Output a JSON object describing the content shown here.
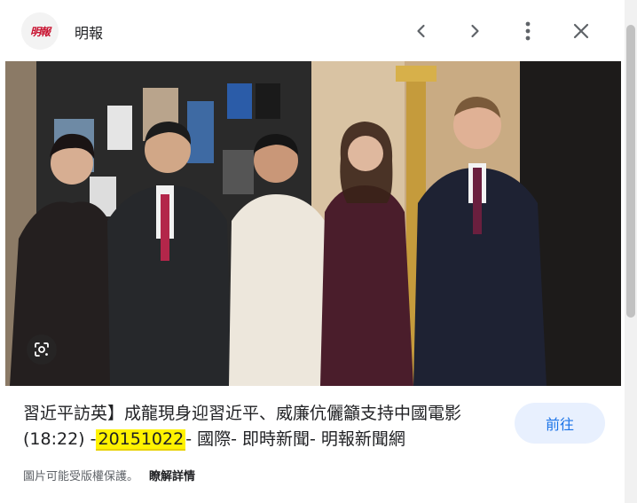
{
  "header": {
    "logo_text": "明報",
    "site_name": "明報",
    "prev_icon": "chevron-left-icon",
    "next_icon": "chevron-right-icon",
    "more_icon": "more-vert-icon",
    "close_icon": "close-icon"
  },
  "image": {
    "lens_icon": "google-lens-icon"
  },
  "result": {
    "title_part1": "習近平訪英】成龍現身迎習近平、威廉伉儷籲支持中國電影(18:22) -",
    "title_highlight": "20151022",
    "title_part2": "- 國際- 即時新聞- 明報新聞網",
    "go_button": "前往",
    "copyright_note": "圖片可能受版權保護。",
    "details_link": "瞭解詳情"
  },
  "colors": {
    "accent": "#1a73e8",
    "button_bg": "#e8f0fe",
    "highlight": "#fff200",
    "logo_red": "#c8102e"
  }
}
